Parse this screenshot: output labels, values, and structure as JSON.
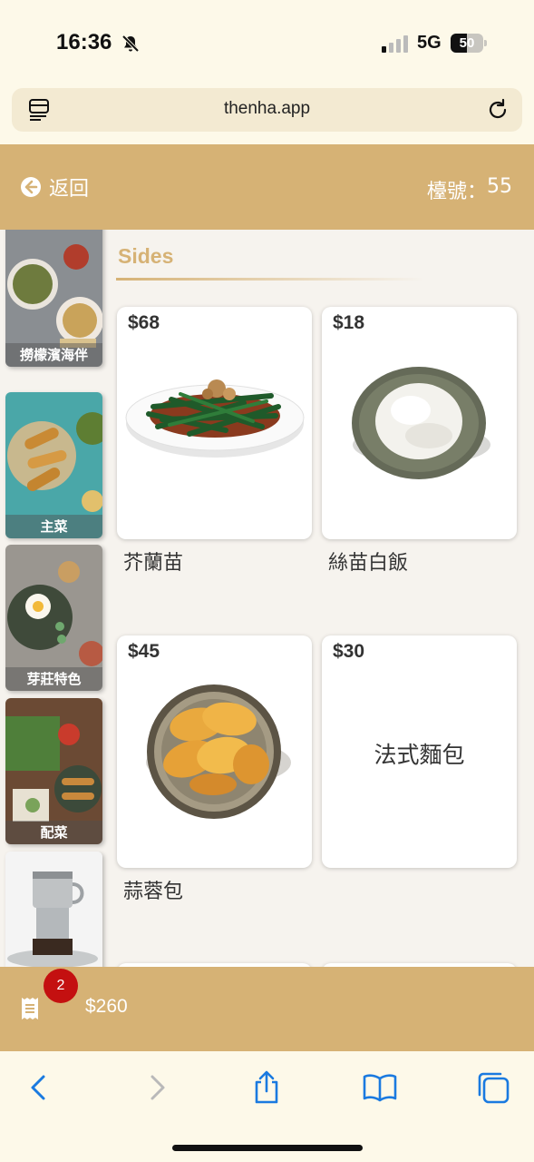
{
  "status_bar": {
    "time": "16:36",
    "network": "5G",
    "battery_percent": 50,
    "battery_label": "50"
  },
  "browser": {
    "url": "thenha.app"
  },
  "header": {
    "back_label": "返回",
    "table_label": "檯號：",
    "table_number": "55"
  },
  "sidebar": {
    "categories": [
      {
        "label": "撈檬濱海伴"
      },
      {
        "label": "主菜"
      },
      {
        "label": "芽莊特色"
      },
      {
        "label": "配菜"
      },
      {
        "label": ""
      }
    ]
  },
  "section": {
    "title": "Sides"
  },
  "items": [
    {
      "price": "$68",
      "name": "芥蘭苗",
      "image": "greens-dish"
    },
    {
      "price": "$18",
      "name": "絲苗白飯",
      "image": "rice-bowl"
    },
    {
      "price": "$45",
      "name": "蒜蓉包",
      "image": "garlic-bread"
    },
    {
      "price": "$30",
      "name": "",
      "placeholder": "法式麵包",
      "image": "none"
    }
  ],
  "cart": {
    "count": "2",
    "total": "$260"
  },
  "colors": {
    "accent": "#d6b275",
    "badge": "#c41010",
    "ios_blue": "#1a7ae0"
  }
}
